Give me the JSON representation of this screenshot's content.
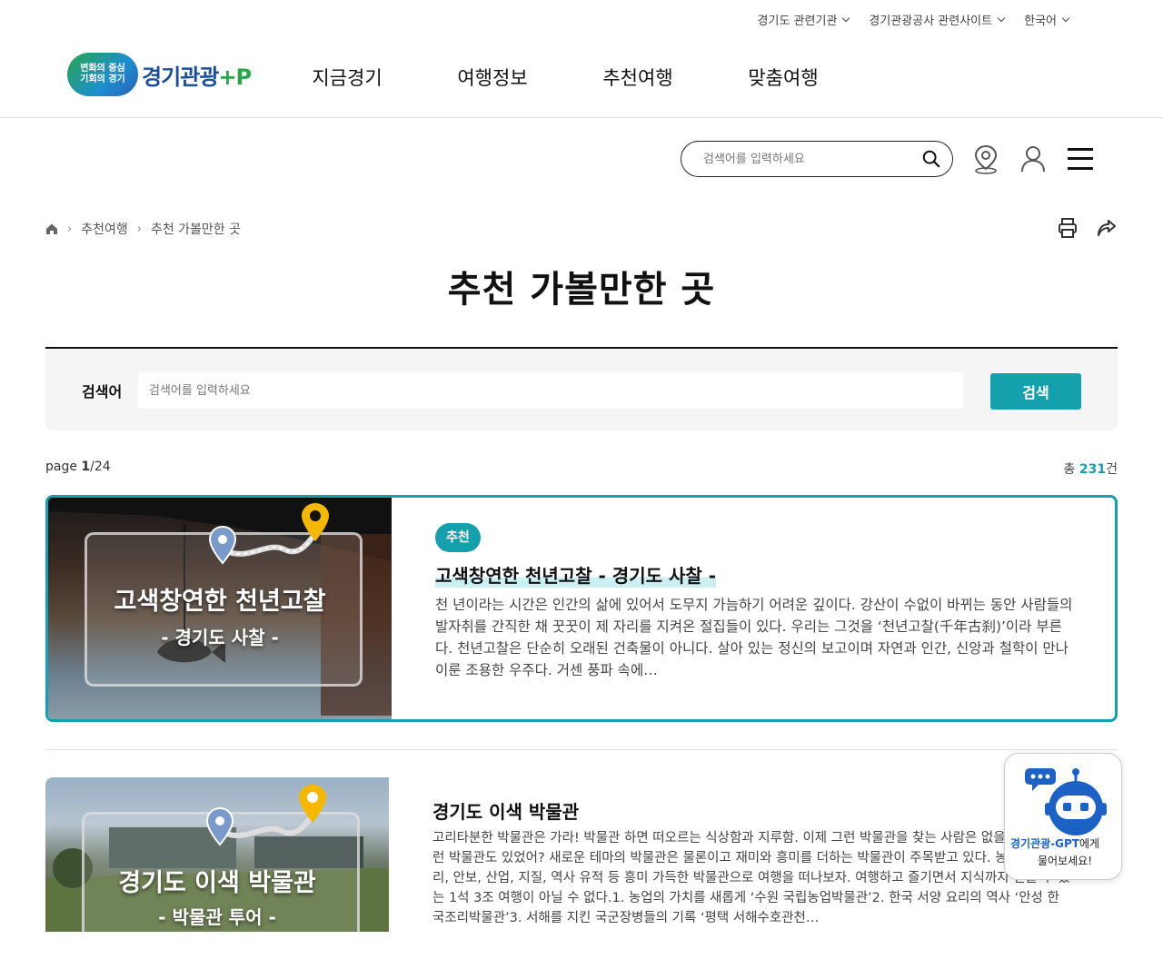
{
  "util": {
    "links": [
      "경기도 관련기관",
      "경기관광공사 관련사이트",
      "한국어"
    ]
  },
  "logo": {
    "badge_line1": "변화의 중심",
    "badge_line2": "기회의 경기",
    "text": "경기관광",
    "plus": "+P"
  },
  "gnb": [
    "지금경기",
    "여행정보",
    "추천여행",
    "맞춤여행"
  ],
  "top_search": {
    "placeholder": "검색어를 입력하세요"
  },
  "icons": {
    "search": "search-icon",
    "location": "map-pin-icon",
    "user": "user-icon",
    "menu": "hamburger-icon",
    "home": "home-icon",
    "print": "print-icon",
    "share": "share-icon"
  },
  "breadcrumb": [
    "추천여행",
    "추천 가볼만한 곳"
  ],
  "page_title": "추천 가볼만한 곳",
  "search_panel": {
    "label": "검색어",
    "placeholder": "검색어를 입력하세요",
    "button": "검색"
  },
  "pager": {
    "prefix": "page",
    "current": "1",
    "total": "24"
  },
  "total_count": {
    "prefix": "총",
    "count": "231",
    "suffix": "건"
  },
  "cards": [
    {
      "thumb_title": "고색창연한 천년고찰",
      "thumb_sub": "- 경기도 사찰 -",
      "badge": "추천",
      "title": "고색창연한 천년고찰 - 경기도 사찰 -",
      "desc": "천 년이라는 시간은 인간의 삶에 있어서 도무지 가늠하기 어려운 깊이다. 강산이 수없이 바뀌는 동안 사람들의 발자취를 간직한 채 꿋꿋이 제 자리를 지켜온 절집들이 있다. 우리는 그것을 ‘천년고찰(千年古刹)’이라 부른다. 천년고찰은 단순히 오래된 건축물이 아니다. 살아 있는 정신의 보고이며 자연과 인간, 신앙과 철학이 만나 이룬 조용한 우주다. 거센 풍파 속에…"
    },
    {
      "thumb_title": "경기도 이색 박물관",
      "thumb_sub": "- 박물관 투어 -",
      "title": "경기도 이색 박물관",
      "desc": "고리타분한 박물관은 가라! 박물관 하면 떠오르는 식상함과 지루함. 이제 그런 박물관을 찾는 사람은 없을 것이다. 이런 박물관도 있었어? 새로운 테마의 박물관은 물론이고 재미와 흥미를 더하는 박물관이 주목받고 있다. 농업, 양식 조리, 안보, 산업, 지질, 역사 유적 등 흥미 가득한 박물관으로 여행을 떠나보자. 여행하고 즐기면서 지식까지 얻을 수 있는 1석 3조 여행이 아닐 수 없다.1. 농업의 가치를 새롭게 ‘수원 국립농업박물관’2. 한국 서양 요리의 역사 ‘안성 한국조리박물관’3. 서해를 지킨 국군장병들의 기록 ‘평택 서해수호관천…"
    }
  ],
  "gpt": {
    "name": "경기관광-GPT",
    "line1_suffix": "에게",
    "line2": "물어보세요!"
  },
  "colors": {
    "accent": "#15a0ad",
    "brand_blue": "#1b4f9c",
    "brand_green": "#2aa64a"
  }
}
